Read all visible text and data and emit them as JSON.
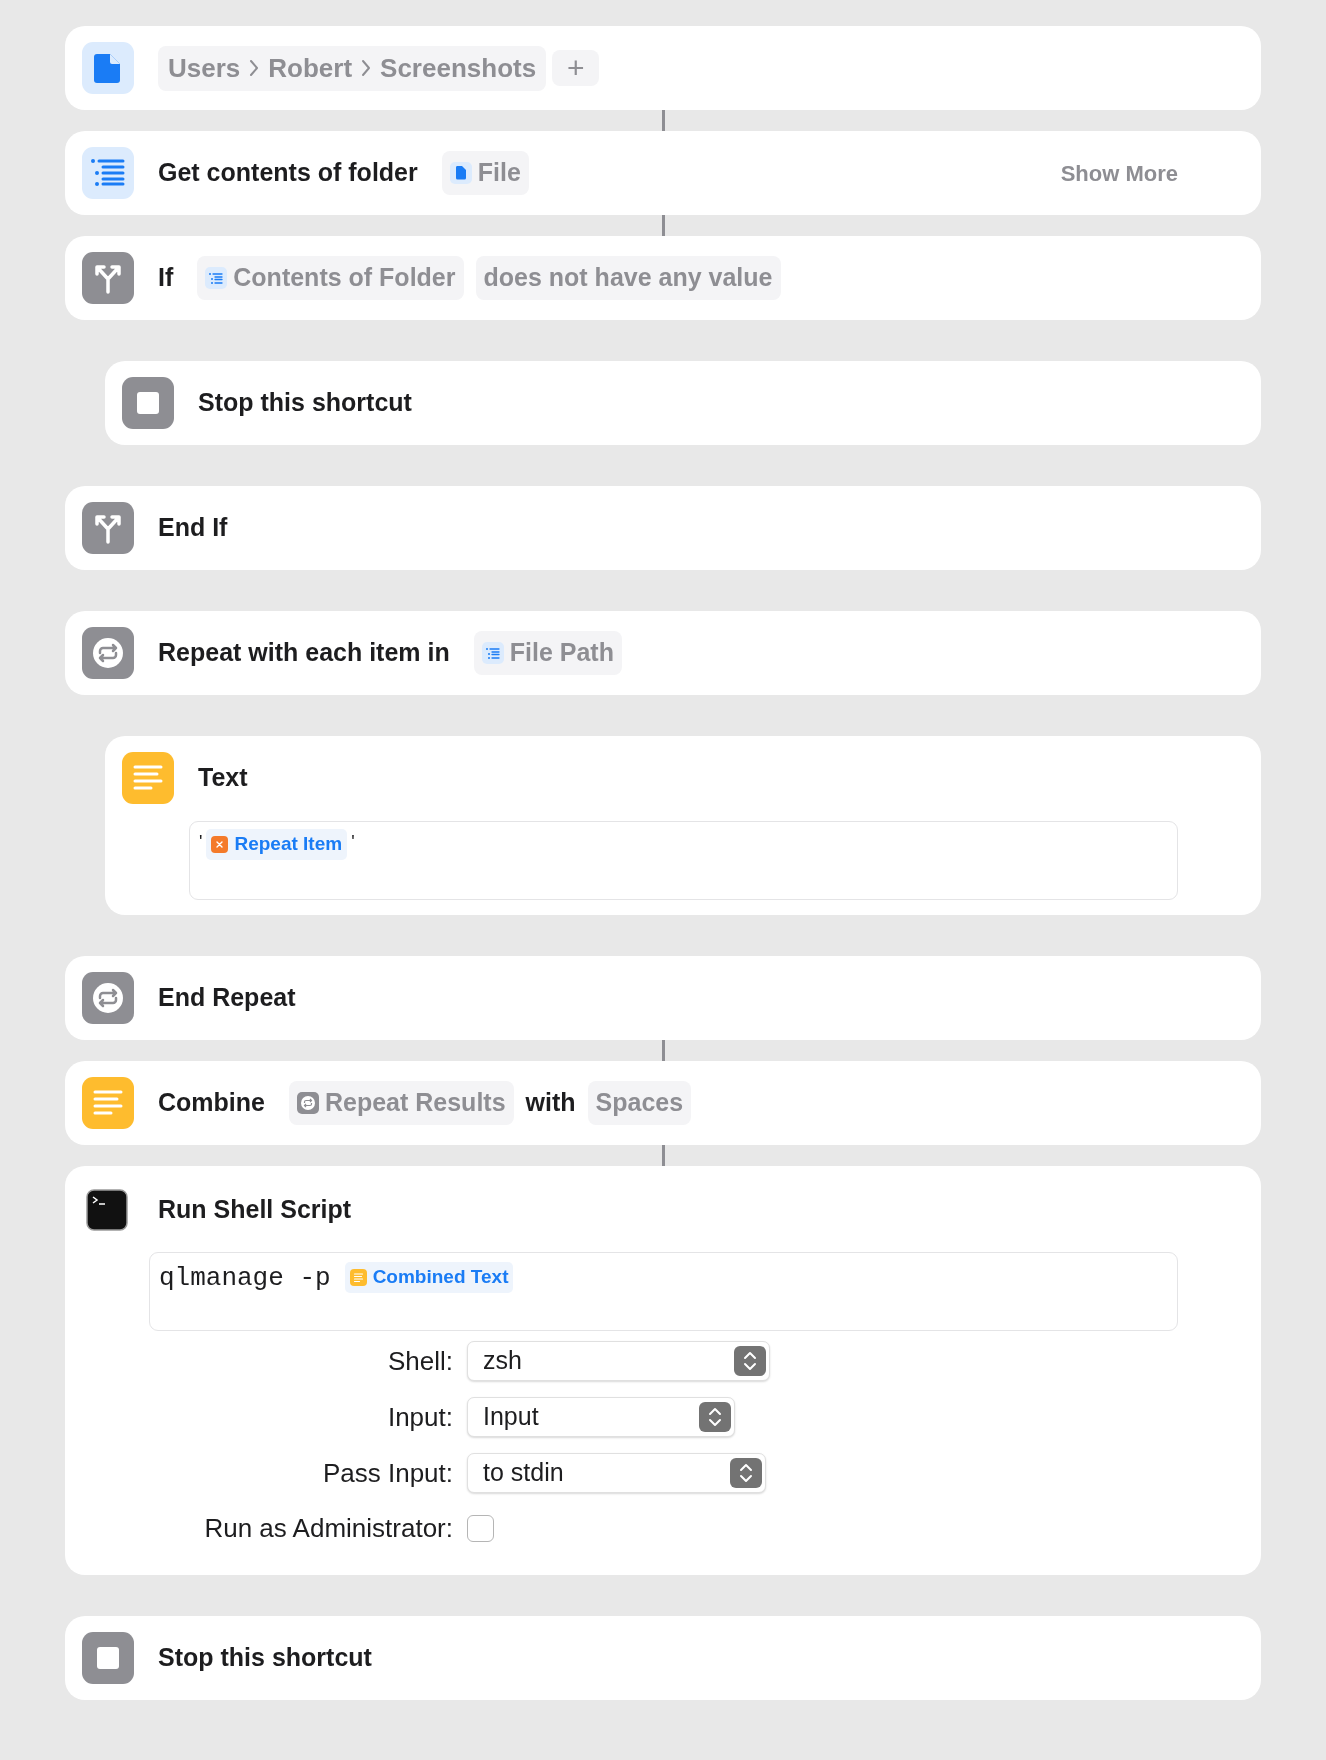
{
  "actions": [
    {
      "kind": "path",
      "path": [
        "Users",
        "Robert",
        "Screenshots"
      ],
      "add_label": "+",
      "connector": true
    },
    {
      "kind": "get_folder",
      "title": "Get contents of folder",
      "parts": [
        {
          "kind": "chip",
          "icon": {
            "kind": "file"
          },
          "text": "File"
        }
      ],
      "show_more": "Show More",
      "connector": true
    },
    {
      "kind": "if",
      "title": "If",
      "parts": [
        {
          "kind": "chip",
          "icon": {
            "kind": "list"
          },
          "text": "Contents of Folder"
        },
        {
          "kind": "chip",
          "text": "does not have any value"
        }
      ],
      "connector": false,
      "children": [
        {
          "kind": "stop",
          "title": "Stop this shortcut",
          "connector": false
        }
      ]
    },
    {
      "kind": "end_if",
      "title": "End If",
      "connector": false
    },
    {
      "kind": "repeat",
      "title": "Repeat with each item in",
      "parts": [
        {
          "kind": "chip",
          "icon": {
            "kind": "list"
          },
          "text": "File Path"
        }
      ],
      "connector": false,
      "children": [
        {
          "kind": "text",
          "title": "Text",
          "body": [
            {
              "kind": "text",
              "text": "'"
            },
            {
              "kind": "token",
              "icon": {
                "kind": "variable"
              },
              "text": "Repeat Item"
            },
            {
              "kind": "text",
              "text": "'"
            }
          ],
          "connector": false
        }
      ]
    },
    {
      "kind": "end_repeat",
      "title": "End Repeat",
      "connector": true
    },
    {
      "kind": "combine",
      "title": "Combine",
      "parts": [
        {
          "kind": "chip",
          "icon": {
            "kind": "repeat"
          },
          "text": "Repeat Results"
        },
        {
          "kind": "word",
          "text": "with"
        },
        {
          "kind": "chip",
          "text": "Spaces"
        }
      ],
      "connector": true
    },
    {
      "kind": "shell",
      "title": "Run Shell Script",
      "body": [
        {
          "kind": "text",
          "text": "qlmanage -p"
        },
        {
          "kind": "token",
          "icon": {
            "kind": "text"
          },
          "text": "Combined Text"
        }
      ],
      "options": [
        {
          "kind": "select",
          "label": "Shell:",
          "value": "zsh"
        },
        {
          "kind": "select",
          "label": "Input:",
          "value": "Input"
        },
        {
          "kind": "select",
          "label": "Pass Input:",
          "value": "to stdin"
        },
        {
          "kind": "checkbox",
          "label": "Run as Administrator:",
          "checked": false
        }
      ],
      "connector": false
    },
    {
      "kind": "stop",
      "title": "Stop this shortcut",
      "connector": false
    }
  ]
}
